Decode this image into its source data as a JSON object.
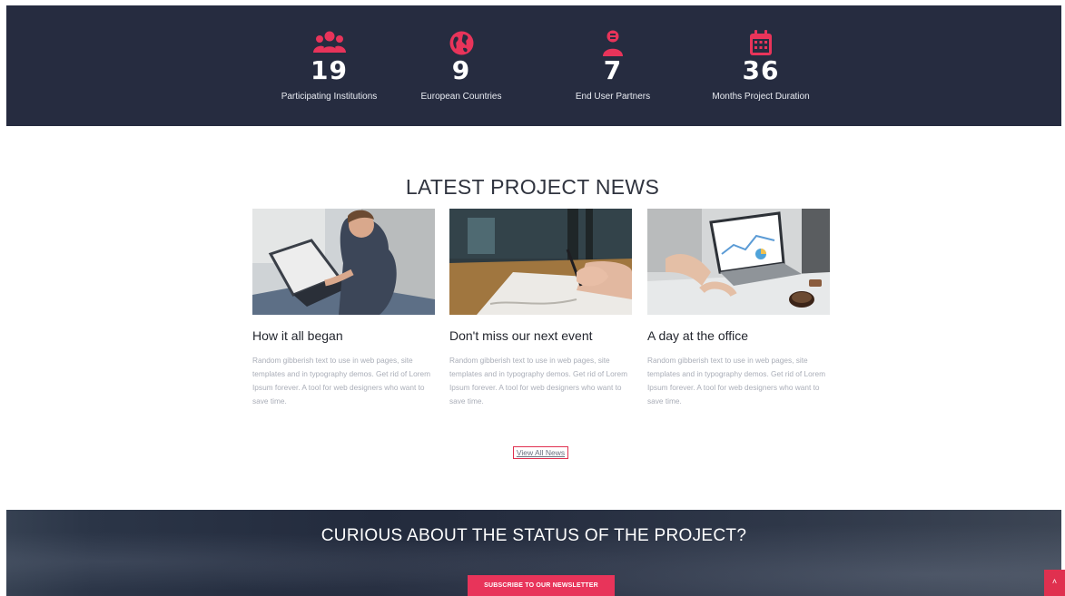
{
  "stats": [
    {
      "icon": "users-group-icon",
      "number": "19",
      "label": "Participating Institutions"
    },
    {
      "icon": "globe-icon",
      "number": "9",
      "label": "European Countries"
    },
    {
      "icon": "user-partner-icon",
      "number": "7",
      "label": "End User Partners"
    },
    {
      "icon": "calendar-icon",
      "number": "36",
      "label": "Months Project Duration"
    }
  ],
  "news": {
    "title": "LATEST PROJECT NEWS",
    "cards": [
      {
        "image": "laptop-on-lap-photo",
        "title": "How it all began",
        "text": "Random gibberish text to use in web pages, site templates and in typography demos. Get rid of Lorem Ipsum forever. A tool for web designers who want to save time."
      },
      {
        "image": "writing-hand-photo",
        "title": "Don't miss our next event",
        "text": "Random gibberish text to use in web pages, site templates and in typography demos. Get rid of Lorem Ipsum forever. A tool for web designers who want to save time."
      },
      {
        "image": "laptop-charts-photo",
        "title": "A day at the office",
        "text": "Random gibberish text to use in web pages, site templates and in typography demos. Get rid of Lorem Ipsum forever. A tool for web designers who want to save time."
      }
    ],
    "view_all_label": "View All News"
  },
  "cta": {
    "title": "CURIOUS ABOUT THE STATUS OF THE PROJECT?",
    "button_label": "SUBSCRIBE TO OUR NEWSLETTER"
  },
  "scroll_top_icon": "chevron-up-icon",
  "colors": {
    "accent": "#e8345a",
    "band": "#262c40",
    "text_muted": "#aaaeb8"
  }
}
